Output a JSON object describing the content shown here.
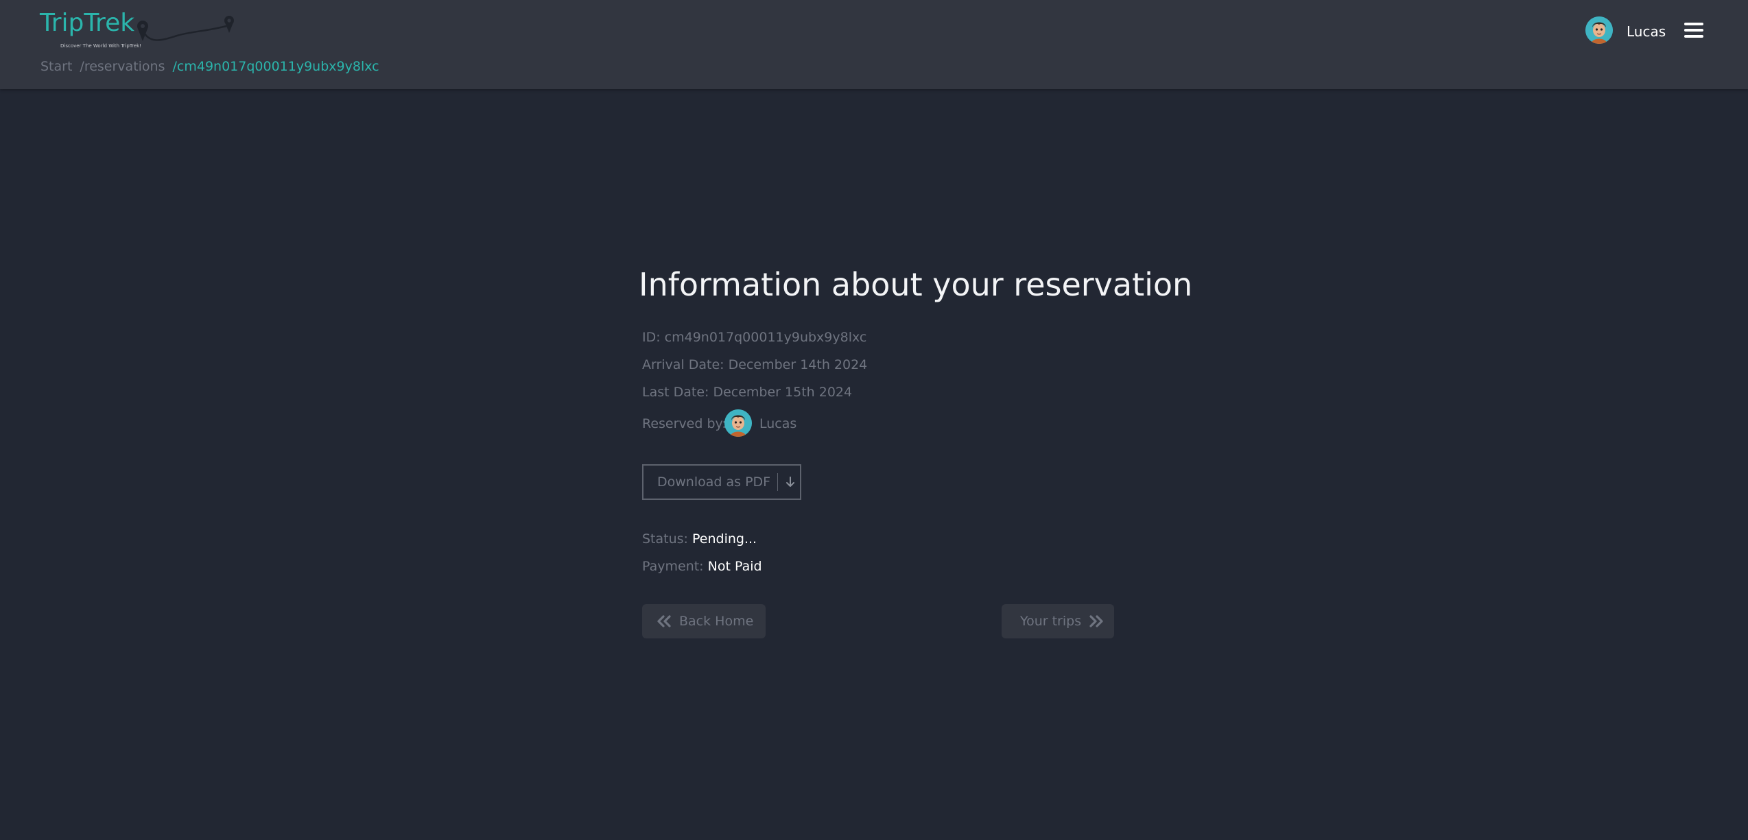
{
  "header": {
    "logo_text": "TripTrek",
    "logo_tagline": "Discover The World With TripTrek!",
    "breadcrumb": {
      "start": "Start",
      "reservations": "/reservations",
      "current": "/cm49n017q00011y9ubx9y8lxc"
    },
    "user_name": "Lucas",
    "avatar_icon": "user-avatar-icon",
    "menu_icon": "hamburger-menu-icon"
  },
  "reservation": {
    "title": "Information about your reservation",
    "id_line": "ID: cm49n017q00011y9ubx9y8lxc",
    "arrival_line": "Arrival Date: December 14th 2024",
    "last_line": "Last Date: December 15th 2024",
    "reserved_by_label": "Reserved by:",
    "reserved_by_name": "Lucas",
    "download_label": "Download as PDF",
    "download_icon": "arrow-down-icon",
    "status_label": "Status:",
    "status_value": "Pending...",
    "payment_label": "Payment:",
    "payment_value": "Not Paid",
    "back_home_label": "Back Home",
    "back_home_icon": "double-chevron-left-icon",
    "your_trips_label": "Your trips",
    "your_trips_icon": "double-chevron-right-icon"
  },
  "colors": {
    "background": "#222733",
    "header": "#323640",
    "accent": "#2bb5ac",
    "muted_text": "#6f7480"
  }
}
